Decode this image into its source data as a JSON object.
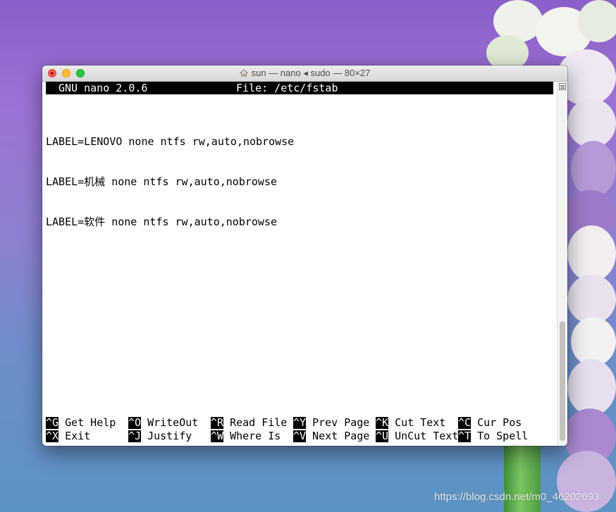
{
  "window": {
    "title": "sun — nano ◂ sudo — 80×27"
  },
  "nano": {
    "version": "GNU nano 2.0.6",
    "file": "File: /etc/fstab"
  },
  "buffer": {
    "lines": [
      "LABEL=LENOVO none ntfs rw,auto,nobrowse",
      "LABEL=机械 none ntfs rw,auto,nobrowse",
      "LABEL=软件 none ntfs rw,auto,nobrowse"
    ]
  },
  "shortcuts": {
    "row1": [
      {
        "key": "^G",
        "label": "Get Help"
      },
      {
        "key": "^O",
        "label": "WriteOut"
      },
      {
        "key": "^R",
        "label": "Read File"
      },
      {
        "key": "^Y",
        "label": "Prev Page"
      },
      {
        "key": "^K",
        "label": "Cut Text"
      },
      {
        "key": "^C",
        "label": "Cur Pos"
      }
    ],
    "row2": [
      {
        "key": "^X",
        "label": "Exit"
      },
      {
        "key": "^J",
        "label": "Justify"
      },
      {
        "key": "^W",
        "label": "Where Is"
      },
      {
        "key": "^V",
        "label": "Next Page"
      },
      {
        "key": "^U",
        "label": "UnCut Text"
      },
      {
        "key": "^T",
        "label": "To Spell"
      }
    ]
  },
  "desktop": {
    "watermark": "https://blog.csdn.net/m0_46202693"
  },
  "icons": [
    "home-icon",
    "scrollbar-menu-icon"
  ],
  "colors": {
    "close": "#fe5f57",
    "minimize": "#febc2e",
    "maximize": "#28c840",
    "terminal_bg": "#ffffff",
    "inverse_bg": "#000000"
  }
}
